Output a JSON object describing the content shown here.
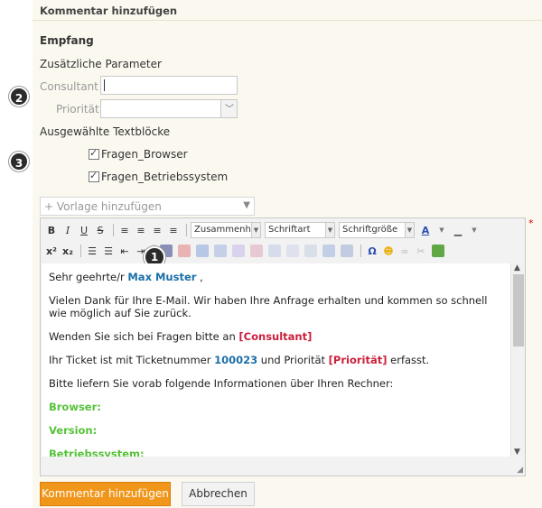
{
  "panel": {
    "header": "Kommentar hinzufügen"
  },
  "form": {
    "recipient_label": "Empfang",
    "params_label": "Zusätzliche Parameter",
    "consultant_label": "Consultant",
    "consultant_value": "",
    "priority_label": "Priorität",
    "priority_value": "",
    "textblocks_label": "Ausgewählte Textblöcke",
    "textblocks": [
      {
        "label": "Fragen_Browser",
        "checked": true
      },
      {
        "label": "Fragen_Betriebssystem",
        "checked": true
      }
    ],
    "template_placeholder": "+ Vorlage hinzufügen"
  },
  "badges": [
    "1",
    "2",
    "3"
  ],
  "toolbar": {
    "bold": "B",
    "italic": "I",
    "underline": "U",
    "strike": "S",
    "format_combo": "Zusammenhänge",
    "font_combo": "Schriftart",
    "size_combo": "Schriftgröße",
    "font_color": "A",
    "superscript": "x²",
    "subscript": "x₂",
    "special_char": "Ω"
  },
  "editor": {
    "greeting_prefix": "Sehr geehrte/r",
    "customer_name": "Max Muster",
    "greeting_suffix": ",",
    "thanks": "Vielen Dank für Ihre E-Mail. Wir haben Ihre Anfrage erhalten und kommen so schnell wie möglich auf Sie zurück.",
    "contact_prefix": "Wenden Sie sich bei Fragen bitte an",
    "contact_var": "[Consultant]",
    "ticket_prefix": "Ihr Ticket ist mit Ticketnummer",
    "ticket_number": "100023",
    "ticket_mid": "und Priorität",
    "ticket_priority_var": "[Priorität]",
    "ticket_suffix": "erfasst.",
    "info_request": "Bitte liefern Sie vorab folgende Informationen über Ihren Rechner:",
    "browser_label": "Browser:",
    "version_label": "Version:",
    "os_label": "Betriebssystem:"
  },
  "buttons": {
    "submit": "Kommentar hinzufügen",
    "cancel": "Abbrechen"
  },
  "colors": {
    "accent": "#f0961b",
    "variable_red": "#cc1f3a",
    "value_blue": "#1b6fa8",
    "section_green": "#56c23a"
  }
}
